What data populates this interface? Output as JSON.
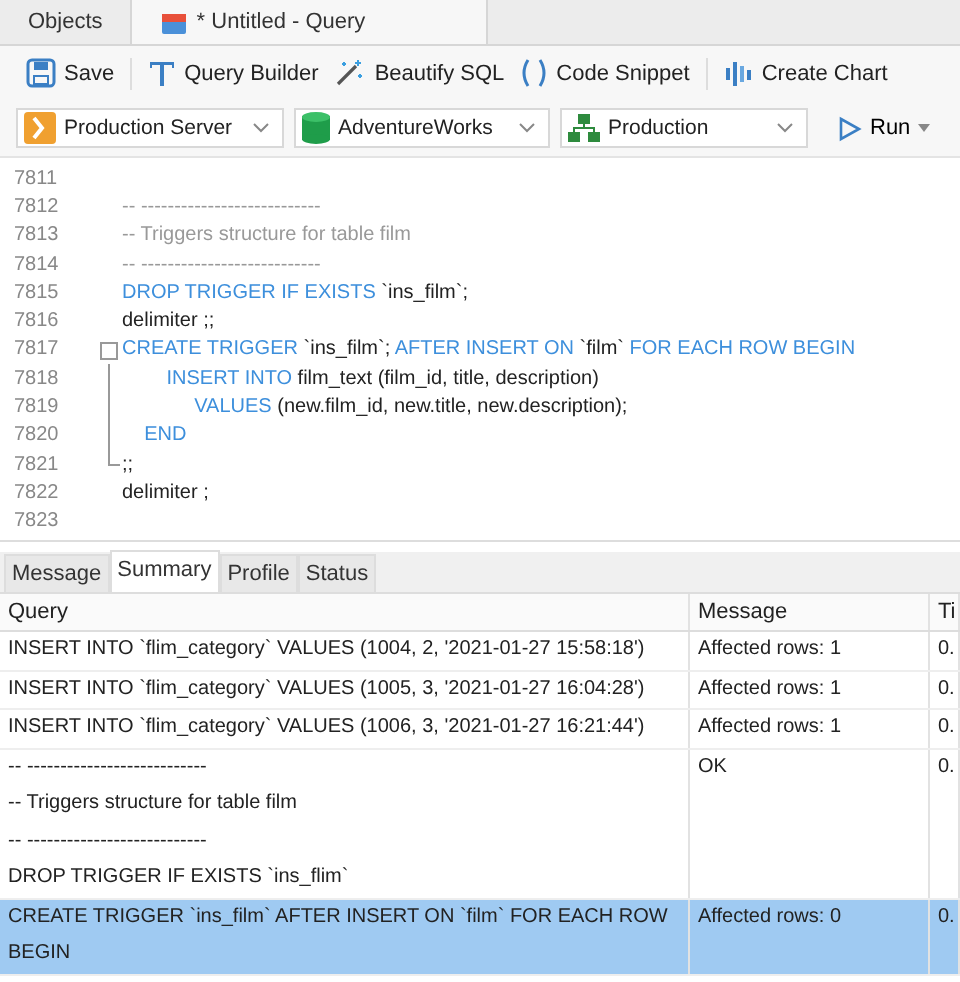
{
  "tabs": [
    {
      "label": "Objects",
      "selected": false,
      "kind": "browser"
    },
    {
      "label": "* Untitled - Query",
      "selected": true,
      "kind": "query"
    }
  ],
  "toolbar": [
    {
      "label": "Save",
      "kind": "save"
    },
    {
      "label": "Query Builder",
      "kind": "builder"
    },
    {
      "label": "Beautify SQL",
      "kind": "beautify"
    },
    {
      "label": "Code Snippet",
      "kind": "snippet"
    },
    {
      "label": "Create Chart",
      "kind": "chart"
    }
  ],
  "selectors": [
    {
      "label": "Production Server",
      "kind": "server"
    },
    {
      "label": "AdventureWorks",
      "kind": "database"
    },
    {
      "label": "Production",
      "kind": "schema"
    }
  ],
  "run_button": {
    "label": "Run"
  },
  "editor": {
    "lines": [
      {
        "number": "7811",
        "kind": "plain"
      },
      {
        "number": "7812",
        "kind": "plain",
        "tokens": [
          {
            "kind": "comment",
            "text": "-- ---------------------------"
          }
        ]
      },
      {
        "number": "7813",
        "kind": "plain",
        "tokens": [
          {
            "kind": "comment",
            "text": "-- Triggers structure for table film"
          }
        ]
      },
      {
        "number": "7814",
        "kind": "plain",
        "tokens": [
          {
            "kind": "comment",
            "text": "-- ---------------------------"
          }
        ]
      },
      {
        "number": "7815",
        "kind": "plain",
        "tokens": [
          {
            "kind": "keyword",
            "text": "DROP TRIGGER IF EXISTS"
          },
          {
            "kind": "plain",
            "text": " `ins_film`;"
          }
        ]
      },
      {
        "number": "7816",
        "kind": "plain",
        "tokens": [
          {
            "kind": "plain",
            "text": "delimiter ;;"
          }
        ]
      },
      {
        "number": "7817",
        "kind": "fold_start",
        "tokens": [
          {
            "kind": "keyword",
            "text": "CREATE TRIGGER"
          },
          {
            "kind": "plain",
            "text": " `ins_film`; "
          },
          {
            "kind": "keyword",
            "text": "AFTER INSERT ON"
          },
          {
            "kind": "plain",
            "text": " `film` "
          },
          {
            "kind": "keyword",
            "text": "FOR EACH ROW BEGIN"
          }
        ]
      },
      {
        "number": "7818",
        "kind": "fold_body",
        "tokens": [
          {
            "kind": "keyword",
            "text": "        INSERT INTO"
          },
          {
            "kind": "plain",
            "text": " film_text (film_id, title, description)"
          }
        ]
      },
      {
        "number": "7819",
        "kind": "fold_body",
        "tokens": [
          {
            "kind": "keyword",
            "text": "             VALUES"
          },
          {
            "kind": "plain",
            "text": " (new.film_id, new.title, new.description);"
          }
        ]
      },
      {
        "number": "7820",
        "kind": "fold_body",
        "tokens": [
          {
            "kind": "keyword",
            "text": "    END"
          }
        ]
      },
      {
        "number": "7821",
        "kind": "fold_end",
        "tokens": [
          {
            "kind": "plain",
            "text": ";;"
          }
        ]
      },
      {
        "number": "7822",
        "kind": "plain",
        "tokens": [
          {
            "kind": "plain",
            "text": "delimiter ;"
          }
        ]
      },
      {
        "number": "7823",
        "kind": "plain"
      }
    ]
  },
  "result_tabs": [
    {
      "label": "Message",
      "selected": false
    },
    {
      "label": "Summary",
      "selected": true
    },
    {
      "label": "Profile",
      "selected": false
    },
    {
      "label": "Status",
      "selected": false
    }
  ],
  "table": {
    "columns": [
      "Query",
      "Message",
      "Ti"
    ],
    "rows": [
      {
        "selected": false,
        "cells": [
          "INSERT INTO `flim_category` VALUES (1004, 2, '2021-01-27 15:58:18')",
          "Affected rows: 1",
          "0."
        ]
      },
      {
        "selected": false,
        "cells": [
          "INSERT INTO `flim_category` VALUES (1005, 3, '2021-01-27 16:04:28')",
          "Affected rows: 1",
          "0."
        ]
      },
      {
        "selected": false,
        "cells": [
          "INSERT INTO `flim_category` VALUES (1006, 3, '2021-01-27 16:21:44')",
          "Affected rows: 1",
          "0."
        ]
      },
      {
        "selected": false,
        "cells": [
          "-- ---------------------------\n-- Triggers structure for table film\n-- ---------------------------\nDROP TRIGGER IF EXISTS `ins_flim`",
          "OK",
          "0."
        ]
      },
      {
        "selected": true,
        "cells": [
          "CREATE TRIGGER `ins_film` AFTER INSERT ON `film` FOR EACH ROW\nBEGIN",
          "Affected rows: 0",
          "0."
        ]
      }
    ]
  }
}
